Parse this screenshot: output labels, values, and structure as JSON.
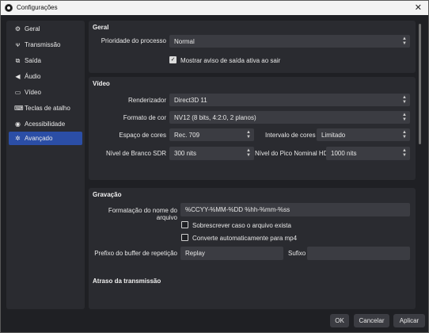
{
  "window": {
    "title": "Configurações",
    "close_icon": "close-icon"
  },
  "sidebar": {
    "items": [
      {
        "label": "Geral",
        "icon": "gear-icon"
      },
      {
        "label": "Transmissão",
        "icon": "antenna-icon"
      },
      {
        "label": "Saída",
        "icon": "output-icon"
      },
      {
        "label": "Áudio",
        "icon": "speaker-icon"
      },
      {
        "label": "Vídeo",
        "icon": "monitor-icon"
      },
      {
        "label": "Teclas de atalho",
        "icon": "keyboard-icon"
      },
      {
        "label": "Acessibilidade",
        "icon": "accessibility-icon"
      },
      {
        "label": "Avançado",
        "icon": "tools-icon"
      }
    ],
    "active_index": 7,
    "active_color": "#2b4ea6"
  },
  "general": {
    "title": "Geral",
    "priority_label": "Prioridade do processo",
    "priority_value": "Normal",
    "show_exit_warning_label": "Mostrar aviso de saída ativa ao sair",
    "show_exit_warning_checked": true
  },
  "video": {
    "title": "Vídeo",
    "renderer_label": "Renderizador",
    "renderer_value": "Direct3D 11",
    "color_format_label": "Formato de cor",
    "color_format_value": "NV12 (8 bits, 4:2:0, 2 planos)",
    "color_space_label": "Espaço de cores",
    "color_space_value": "Rec. 709",
    "color_range_label": "Intervalo de cores",
    "color_range_value": "Limitado",
    "sdr_white_label": "Nível de Branco SDR",
    "sdr_white_value": "300 nits",
    "hdr_peak_label": "Nível do Pico Nominal HDR",
    "hdr_peak_value": "1000 nits"
  },
  "recording": {
    "title": "Gravação",
    "filename_format_label": "Formatação do nome do arquivo",
    "filename_format_value": "%CCYY-%MM-%DD %hh-%mm-%ss",
    "overwrite_label": "Sobrescrever caso o arquivo exista",
    "overwrite_checked": false,
    "remux_label": "Converte automaticamente para mp4",
    "remux_checked": false,
    "replay_prefix_label": "Prefixo do buffer de repetição",
    "replay_prefix_value": "Replay",
    "suffix_label": "Sufixo",
    "suffix_value": ""
  },
  "stream_delay": {
    "title": "Atraso da transmissão"
  },
  "buttons": {
    "ok": "OK",
    "cancel": "Cancelar",
    "apply": "Aplicar"
  }
}
